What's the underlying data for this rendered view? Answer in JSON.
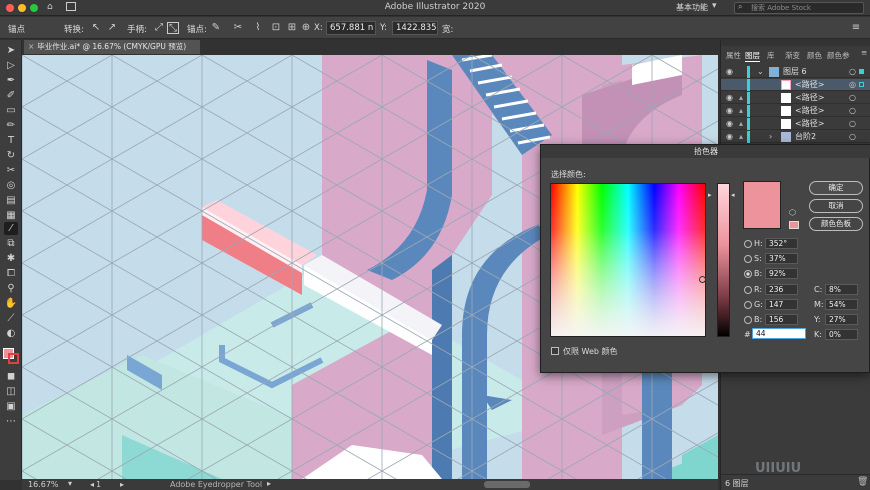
{
  "app": {
    "title": "Adobe Illustrator 2020",
    "workspace_label": "基本功能",
    "stock_search_placeholder": "搜索 Adobe Stock"
  },
  "controlbar": {
    "anchor_label": "锚点",
    "convert_label": "转换:",
    "handle_label": "手柄:",
    "anchor_label2": "锚点:",
    "x_label": "X:",
    "x_value": "657.881 n",
    "y_label": "Y:",
    "y_value": "1422.835",
    "width_label": "宽:"
  },
  "document_tab": {
    "label": "毕业作业.ai* @ 16.67% (CMYK/GPU 预览)"
  },
  "statusbar": {
    "zoom": "16.67%",
    "artboard": "1",
    "tool_name": "Adobe Eyedropper Tool"
  },
  "panel": {
    "tabs": [
      "属性",
      "图层",
      "库",
      "渐变",
      "颜色",
      "颜色参"
    ],
    "layers": [
      {
        "name": "图层 6",
        "thumb": "#7fb0d8"
      },
      {
        "name": "<路径>",
        "thumb": "#f3a0b8"
      },
      {
        "name": "<路径>",
        "thumb": "#ffffff"
      },
      {
        "name": "<路径>",
        "thumb": "#ffffff"
      },
      {
        "name": "<路径>",
        "thumb": "#ffffff"
      },
      {
        "name": "台阶2",
        "thumb": "#a9b9d9"
      }
    ],
    "footer_label": "6 图层",
    "watermark": "UIIUIU"
  },
  "color_picker": {
    "title": "拾色器",
    "select_label": "选择颜色:",
    "ok_button": "确定",
    "cancel_button": "取消",
    "swatches_button": "颜色色板",
    "web_only_label": "仅限 Web 颜色",
    "current_color": "#ec939c",
    "hsb": {
      "h_label": "H:",
      "h": "352°",
      "s_label": "S:",
      "s": "37%",
      "b_label": "B:",
      "b": "92%"
    },
    "rgb": {
      "r_label": "R:",
      "r": "236",
      "g_label": "G:",
      "g": "147",
      "b_label": "B:",
      "b": "156"
    },
    "cmyk": {
      "c_label": "C:",
      "c": "8%",
      "m_label": "M:",
      "m": "54%",
      "y_label": "Y:",
      "y": "27%",
      "k_label": "K:",
      "k": "0%"
    },
    "hex_label": "#",
    "hex": "44"
  },
  "colors": {
    "canvas_bg": "#c5dcea",
    "pink": "#d8a9c9",
    "blue": "#5a88bd",
    "salmon": "#ef7e86",
    "mint": "#c8ebe9",
    "white": "#ffffff",
    "teal": "#7fd6cf"
  }
}
